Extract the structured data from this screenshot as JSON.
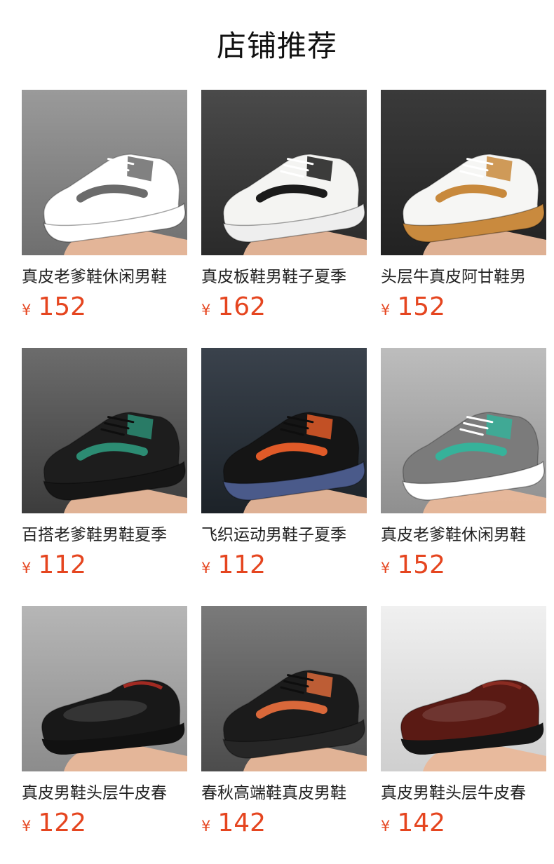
{
  "section_title": "店铺推荐",
  "currency_symbol": "¥",
  "products": [
    {
      "name": "真皮老爹鞋休闲男鞋",
      "price": "152",
      "shoe_icon": "sneaker-white-grey-icon",
      "bg": [
        "#9a9a9a",
        "#6f6f6f"
      ],
      "body": "#ffffff",
      "accent": "#6b6b6b",
      "sole": "#ffffff",
      "lace": "#ffffff"
    },
    {
      "name": "真皮板鞋男鞋子夏季",
      "price": "162",
      "shoe_icon": "sneaker-white-air-cushion-icon",
      "bg": [
        "#4a4a4a",
        "#2a2a2a"
      ],
      "body": "#f4f4f2",
      "accent": "#1b1b1b",
      "sole": "#eeeeee",
      "lace": "#ffffff"
    },
    {
      "name": "头层牛真皮阿甘鞋男",
      "price": "152",
      "shoe_icon": "sneaker-white-tan-icon",
      "bg": [
        "#3a3a3a",
        "#222222"
      ],
      "body": "#f6f6f4",
      "accent": "#c8893c",
      "sole": "#c98a3e",
      "lace": "#ffffff"
    },
    {
      "name": "百搭老爹鞋男鞋夏季",
      "price": "112",
      "shoe_icon": "sneaker-black-icon",
      "bg": [
        "#6c6c6c",
        "#3c3c3c"
      ],
      "body": "#1d1d1d",
      "accent": "#2c8c73",
      "sole": "#161616",
      "lace": "#0e0e0e"
    },
    {
      "name": "飞织运动男鞋子夏季",
      "price": "112",
      "shoe_icon": "sneaker-black-knit-icon",
      "bg": [
        "#3a424c",
        "#1c2228"
      ],
      "body": "#151515",
      "accent": "#e05a28",
      "sole": "#4a5a8a",
      "lace": "#0e0e0e"
    },
    {
      "name": "真皮老爹鞋休闲男鞋",
      "price": "152",
      "shoe_icon": "sneaker-grey-white-icon",
      "bg": [
        "#bdbdbd",
        "#8f8f8f"
      ],
      "body": "#7b7b7b",
      "accent": "#36b29a",
      "sole": "#ffffff",
      "lace": "#ffffff"
    },
    {
      "name": "真皮男鞋头层牛皮春",
      "price": "122",
      "shoe_icon": "loafer-black-icon",
      "bg": [
        "#b6b6b6",
        "#8c8c8c"
      ],
      "body": "#181818",
      "accent": "#a12a22",
      "sole": "#111111",
      "lace": "#181818"
    },
    {
      "name": "春秋高端鞋真皮男鞋",
      "price": "142",
      "shoe_icon": "sneaker-black-leather-icon",
      "bg": [
        "#7a7a7a",
        "#4c4c4c"
      ],
      "body": "#1b1b1b",
      "accent": "#d9683a",
      "sole": "#262626",
      "lace": "#0e0e0e"
    },
    {
      "name": "真皮男鞋头层牛皮春",
      "price": "142",
      "shoe_icon": "oxford-brown-icon",
      "bg": [
        "#f0f0f0",
        "#cfcfcf"
      ],
      "body": "#5a1a14",
      "accent": "#8a2c22",
      "sole": "#151515",
      "lace": "#3a120e"
    }
  ]
}
